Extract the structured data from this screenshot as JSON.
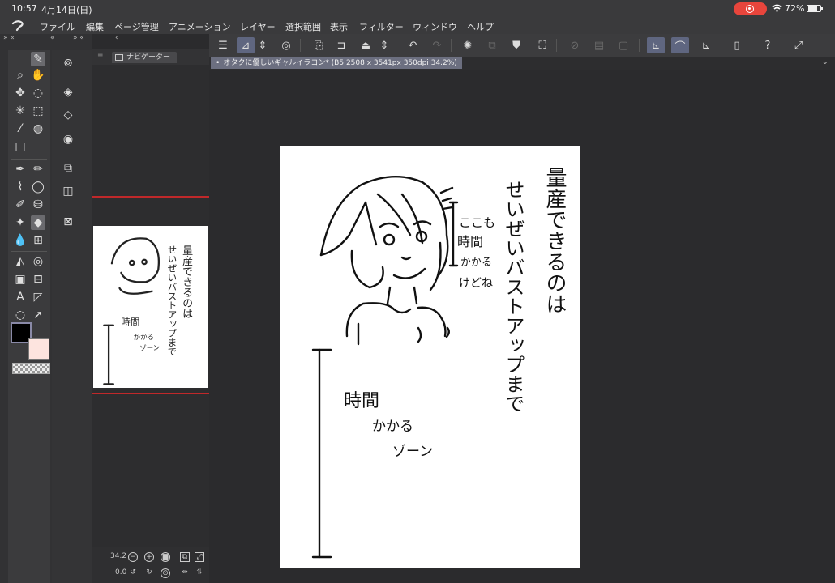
{
  "status": {
    "time": "10:57",
    "date": "4月14日(日)",
    "battery": "72%",
    "battery_level": 0.72
  },
  "menu": [
    "ファイル",
    "編集",
    "ページ管理",
    "アニメーション",
    "レイヤー",
    "選択範囲",
    "表示",
    "フィルター",
    "ウィンドウ",
    "ヘルプ"
  ],
  "navigator": {
    "tab": "ナビゲーター",
    "zoom": "34.2",
    "rotation": "0.0"
  },
  "document": {
    "tab_title": "オタクに優しいギャルイラコン* (B5 2508 x 3541px 350dpi 34.2%)"
  },
  "artwork": {
    "heading": "量産できるのは",
    "heading2": "せいぜいバストアップまで",
    "note_line1": "ここも",
    "note_line2": "時間",
    "note_line3": "かかる",
    "note_line4": "けどね",
    "zone_line1": "時間",
    "zone_line2": "かかる",
    "zone_line3": "ゾーン"
  }
}
